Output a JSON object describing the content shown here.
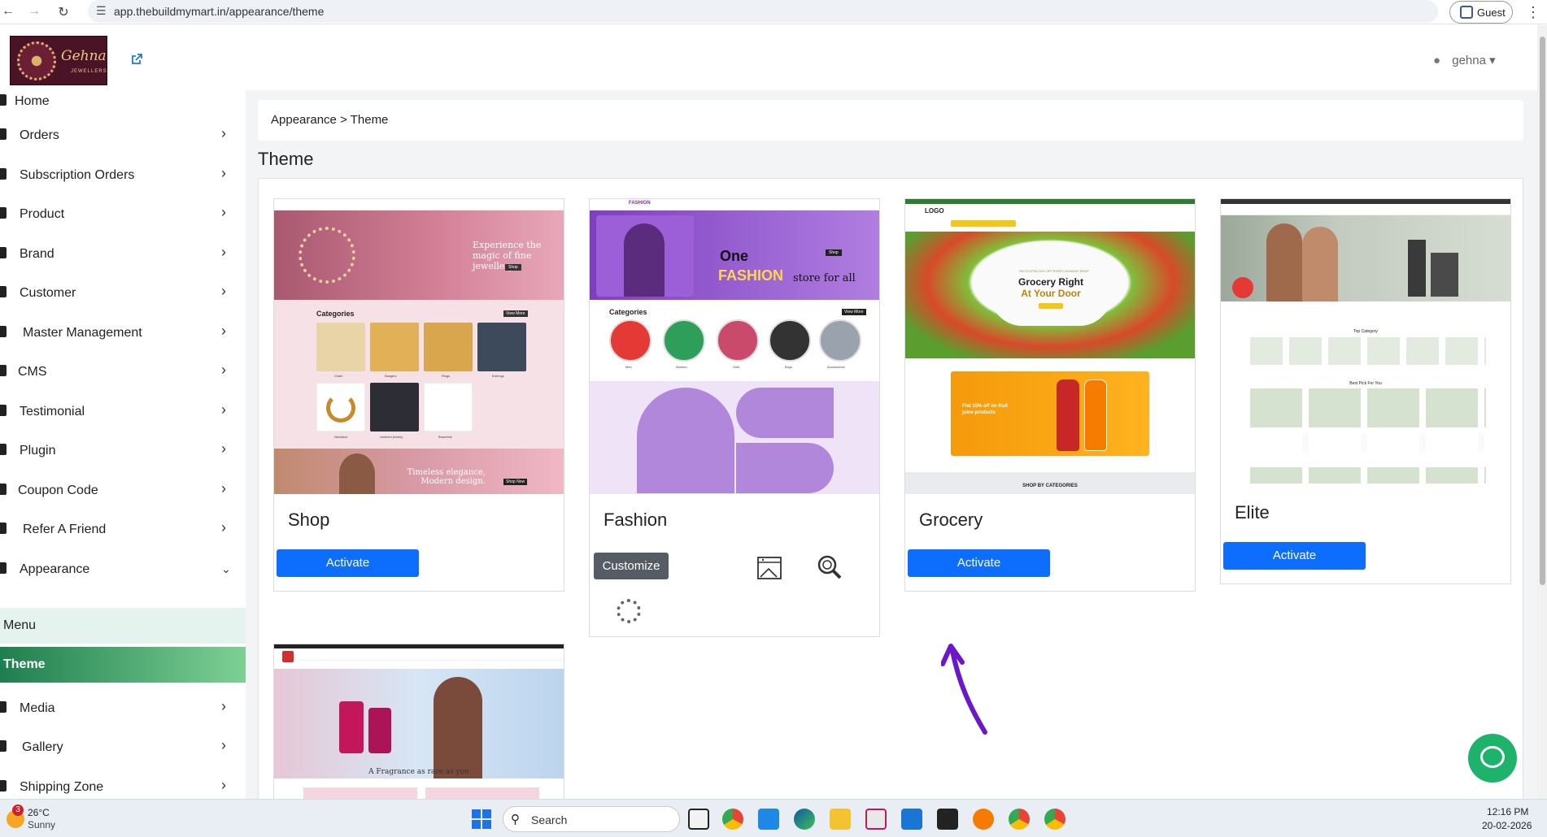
{
  "browser": {
    "url": "app.thebuildmymart.in/appearance/theme",
    "profile_label": "Guest"
  },
  "header": {
    "logo_text": "Gehna",
    "logo_subtext": "JEWELLERS",
    "user_name": "gehna"
  },
  "sidebar": {
    "items": [
      {
        "label": "Home"
      },
      {
        "label": "Orders"
      },
      {
        "label": "Subscription Orders"
      },
      {
        "label": "Product"
      },
      {
        "label": "Brand"
      },
      {
        "label": "Customer"
      },
      {
        "label": "Master Management"
      },
      {
        "label": "CMS"
      },
      {
        "label": "Testimonial"
      },
      {
        "label": "Plugin"
      },
      {
        "label": "Coupon Code"
      },
      {
        "label": "Refer A Friend"
      },
      {
        "label": "Appearance"
      },
      {
        "label": "Menu"
      },
      {
        "label": "Theme"
      },
      {
        "label": "Media"
      },
      {
        "label": "Gallery"
      },
      {
        "label": "Shipping Zone"
      }
    ]
  },
  "main": {
    "breadcrumb": "Appearance > Theme",
    "title": "Theme",
    "themes": [
      {
        "name": "Shop",
        "button": "Activate",
        "preview": {
          "hero": "Experience the magic of fine jewellery",
          "hero_btn": "Shop",
          "section": "Categories",
          "view_more": "View More",
          "cats": [
            "Chain",
            "Bangles",
            "Rings",
            "Earrings",
            "Necklace",
            "oxidized jewelry",
            "Bracelets"
          ],
          "banner": "Timeless elegance, Modern design.",
          "banner_btn": "Shop Now"
        }
      },
      {
        "name": "Fashion",
        "button": "Customize",
        "preview": {
          "logo": "FASHION",
          "hero_one": "One",
          "hero_main": "FASHION",
          "hero_tail": "store for all",
          "hero_btn": "Shop",
          "section": "Categories",
          "view_more": "View More",
          "cats": [
            "Men",
            "Women",
            "Girls",
            "Boys",
            "Accessories"
          ]
        }
      },
      {
        "name": "Grocery",
        "button": "Activate",
        "preview": {
          "logo": "LOGO",
          "hero_kicker": "GET EXTRA 20% OFF EVERY MONDAY SHOP",
          "hero_line1": "Grocery Right",
          "hero_line2": "At Your Door",
          "promo_line1": "Flat 15% off on fruit",
          "promo_line2": "juice products",
          "section": "SHOP BY CATEGORIES"
        }
      },
      {
        "name": "Elite",
        "button": "Activate",
        "preview": {
          "top_category": "Top Category",
          "best_pick": "Best Pick For You"
        }
      }
    ],
    "fifth_theme_preview": {
      "banner": "A Fragrance as rare as you"
    }
  },
  "taskbar": {
    "weather_temp": "26°C",
    "weather_desc": "Sunny",
    "weather_badge": "3",
    "search_label": "Search",
    "time": "12:16 PM",
    "date": "20-02-2026"
  },
  "colors": {
    "primary": "#0d6efd",
    "active_sidebar_start": "#1e7f4e",
    "active_sidebar_end": "#7ed095",
    "customize": "#555c63",
    "chat": "#1db36a",
    "annotation_arrow": "#6a18c9"
  }
}
